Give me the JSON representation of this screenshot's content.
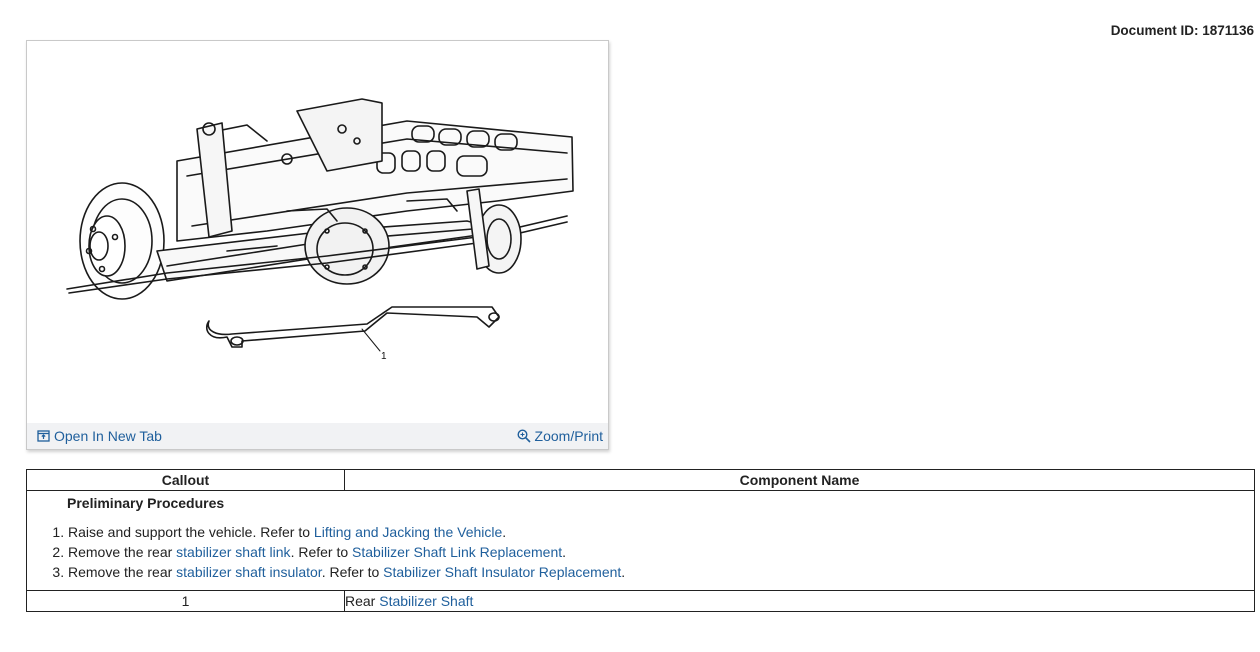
{
  "document": {
    "id_label": "Document ID: 1871136"
  },
  "figure": {
    "callout_label": "1",
    "open_tab_label": "Open In New Tab",
    "zoom_label": "Zoom/Print",
    "open_icon": "open-in-new-tab-icon",
    "zoom_icon": "magnifier-icon"
  },
  "table": {
    "headers": {
      "callout": "Callout",
      "component": "Component Name"
    },
    "preliminary": {
      "title": "Preliminary Procedures",
      "steps": [
        {
          "pre": "Raise and support the vehicle. Refer to ",
          "link": "Lifting and Jacking the Vehicle",
          "post": "."
        },
        {
          "pre": "Remove the rear ",
          "link": "stabilizer shaft link",
          "mid": ". Refer to ",
          "link2": "Stabilizer Shaft Link Replacement",
          "post": "."
        },
        {
          "pre": "Remove the rear ",
          "link": "stabilizer shaft insulator",
          "mid": ". Refer to ",
          "link2": "Stabilizer Shaft Insulator Replacement",
          "post": "."
        }
      ]
    },
    "rows": [
      {
        "callout": "1",
        "name_prefix": "Rear ",
        "name_link": "Stabilizer Shaft"
      }
    ]
  },
  "colors": {
    "link": "#1f5f9c",
    "figure_bar": "#f1f2f4"
  }
}
